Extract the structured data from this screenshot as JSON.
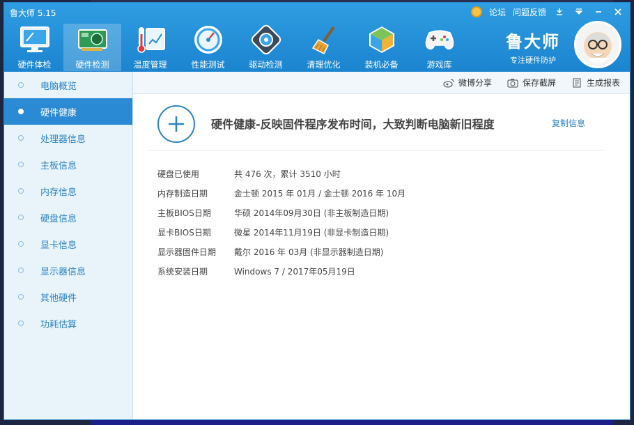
{
  "app": {
    "title": "鲁大师 5.15"
  },
  "title_bar": {
    "forum": "论坛",
    "feedback": "问题反馈"
  },
  "nav": [
    {
      "label": "硬件体检",
      "icon": "monitor-icon"
    },
    {
      "label": "硬件检测",
      "icon": "hardware-card-icon",
      "active": true
    },
    {
      "label": "温度管理",
      "icon": "thermometer-icon"
    },
    {
      "label": "性能测试",
      "icon": "speedometer-icon"
    },
    {
      "label": "驱动检测",
      "icon": "driver-gear-icon"
    },
    {
      "label": "清理优化",
      "icon": "broom-icon"
    },
    {
      "label": "装机必备",
      "icon": "cube-icon"
    },
    {
      "label": "游戏库",
      "icon": "gamepad-icon"
    }
  ],
  "brand": {
    "name": "鲁大师",
    "slogan": "专注硬件防护"
  },
  "sidebar": [
    {
      "label": "电脑概览"
    },
    {
      "label": "硬件健康",
      "active": true
    },
    {
      "label": "处理器信息"
    },
    {
      "label": "主板信息"
    },
    {
      "label": "内存信息"
    },
    {
      "label": "硬盘信息"
    },
    {
      "label": "显卡信息"
    },
    {
      "label": "显示器信息"
    },
    {
      "label": "其他硬件"
    },
    {
      "label": "功耗估算"
    }
  ],
  "toolbar": {
    "weibo_share": "微博分享",
    "save_screenshot": "保存截屏",
    "generate_report": "生成报表"
  },
  "main": {
    "heading": "硬件健康-反映固件程序发布时间，大致判断电脑新旧程度",
    "copy_info": "复制信息",
    "rows": [
      {
        "label": "硬盘已使用",
        "value": "共 476 次，累计 3510 小时"
      },
      {
        "label": "内存制造日期",
        "value": "金士顿 2015 年 01月 / 金士顿 2016 年 10月"
      },
      {
        "label": "主板BIOS日期",
        "value": "华硕 2014年09月30日 (非主板制造日期)"
      },
      {
        "label": "显卡BIOS日期",
        "value": "微星 2014年11月19日 (非显卡制造日期)"
      },
      {
        "label": "显示器固件日期",
        "value": "戴尔 2016 年 03月 (非显示器制造日期)"
      },
      {
        "label": "系统安装日期",
        "value": "Windows 7 / 2017年05月19日"
      }
    ]
  },
  "colors": {
    "header": "#2290d9",
    "accent": "#2d83c4",
    "sidebar_bg": "#e8f3fa"
  }
}
